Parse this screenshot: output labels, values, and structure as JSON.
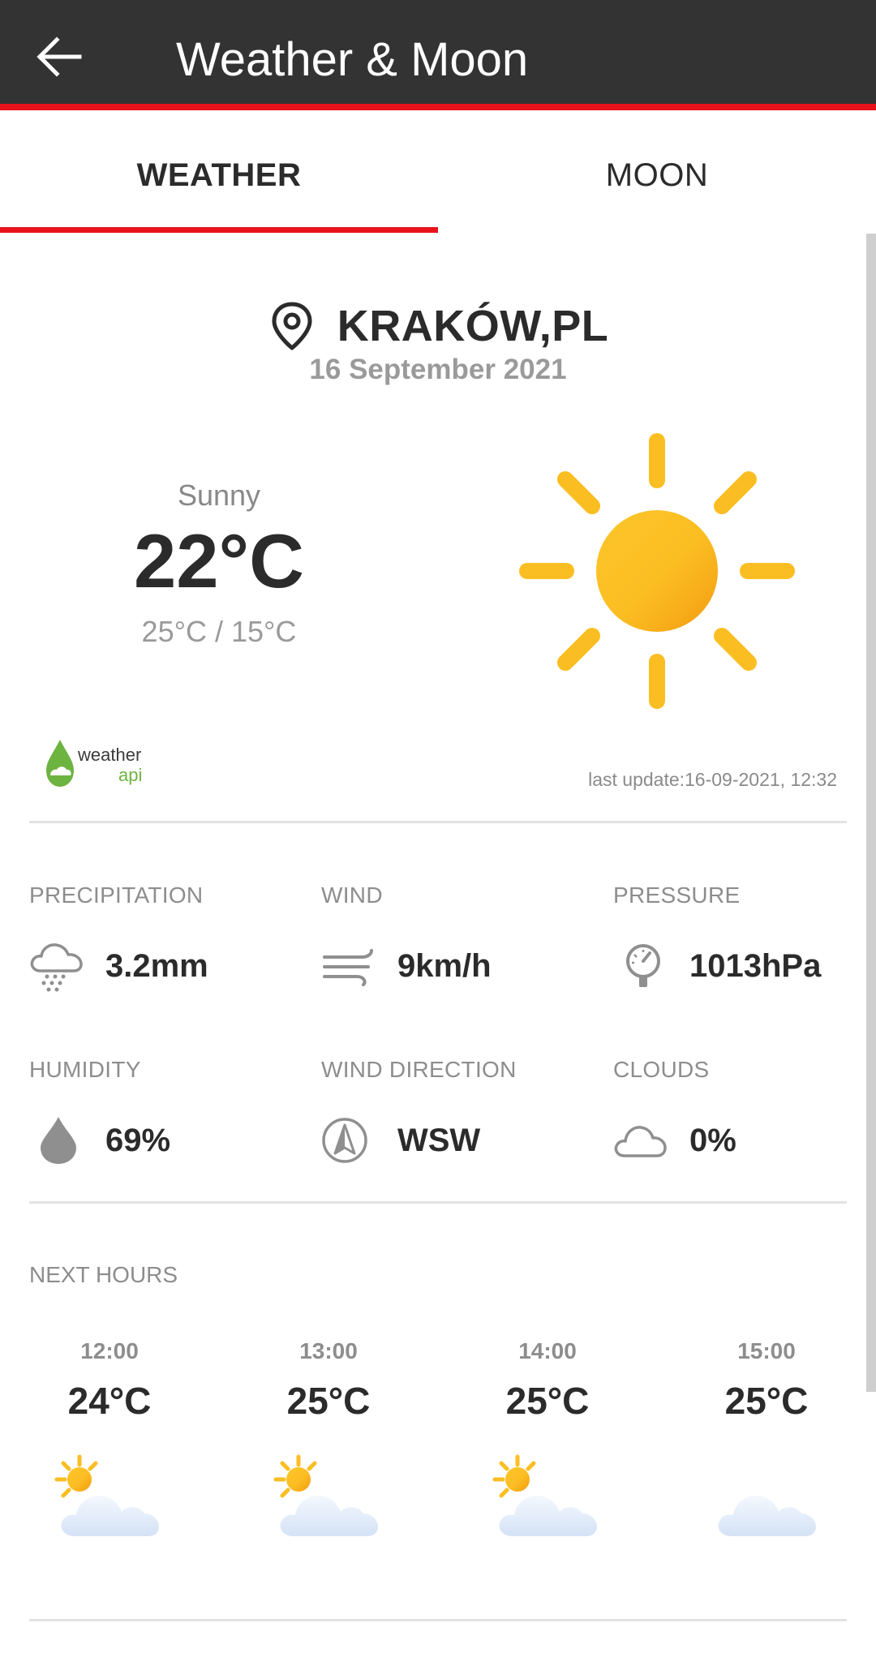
{
  "app_bar": {
    "title": "Weather & Moon"
  },
  "tabs": [
    {
      "label": "WEATHER",
      "active": true
    },
    {
      "label": "MOON",
      "active": false
    }
  ],
  "location": {
    "city": "KRAKÓW,PL",
    "date": "16 September 2021"
  },
  "current": {
    "condition": "Sunny",
    "temperature": "22°C",
    "high_low": "25°C / 15°C",
    "icon": "sun-icon"
  },
  "provider": {
    "logo_top": "weather",
    "logo_bottom": "api"
  },
  "last_update": "last update:16-09-2021, 12:32",
  "stats": {
    "precipitation": {
      "label": "PRECIPITATION",
      "value": "3.2mm",
      "icon": "rain-cloud-icon"
    },
    "wind": {
      "label": "WIND",
      "value": "9km/h",
      "icon": "wind-icon"
    },
    "pressure": {
      "label": "PRESSURE",
      "value": "1013hPa",
      "icon": "gauge-icon"
    },
    "humidity": {
      "label": "HUMIDITY",
      "value": "69%",
      "icon": "drop-icon"
    },
    "wind_direction": {
      "label": "WIND DIRECTION",
      "value": "WSW",
      "icon": "compass-icon"
    },
    "clouds": {
      "label": "CLOUDS",
      "value": "0%",
      "icon": "cloud-icon"
    }
  },
  "next_hours": {
    "label": "NEXT HOURS",
    "items": [
      {
        "time": "12:00",
        "temp": "24°C",
        "icon": "partly-cloudy-icon"
      },
      {
        "time": "13:00",
        "temp": "25°C",
        "icon": "partly-cloudy-icon"
      },
      {
        "time": "14:00",
        "temp": "25°C",
        "icon": "partly-cloudy-icon"
      },
      {
        "time": "15:00",
        "temp": "25°C",
        "icon": "cloudy-icon"
      }
    ]
  },
  "colors": {
    "app_bar": "#333333",
    "accent": "#e8121b",
    "sun": "#fbbe22"
  }
}
